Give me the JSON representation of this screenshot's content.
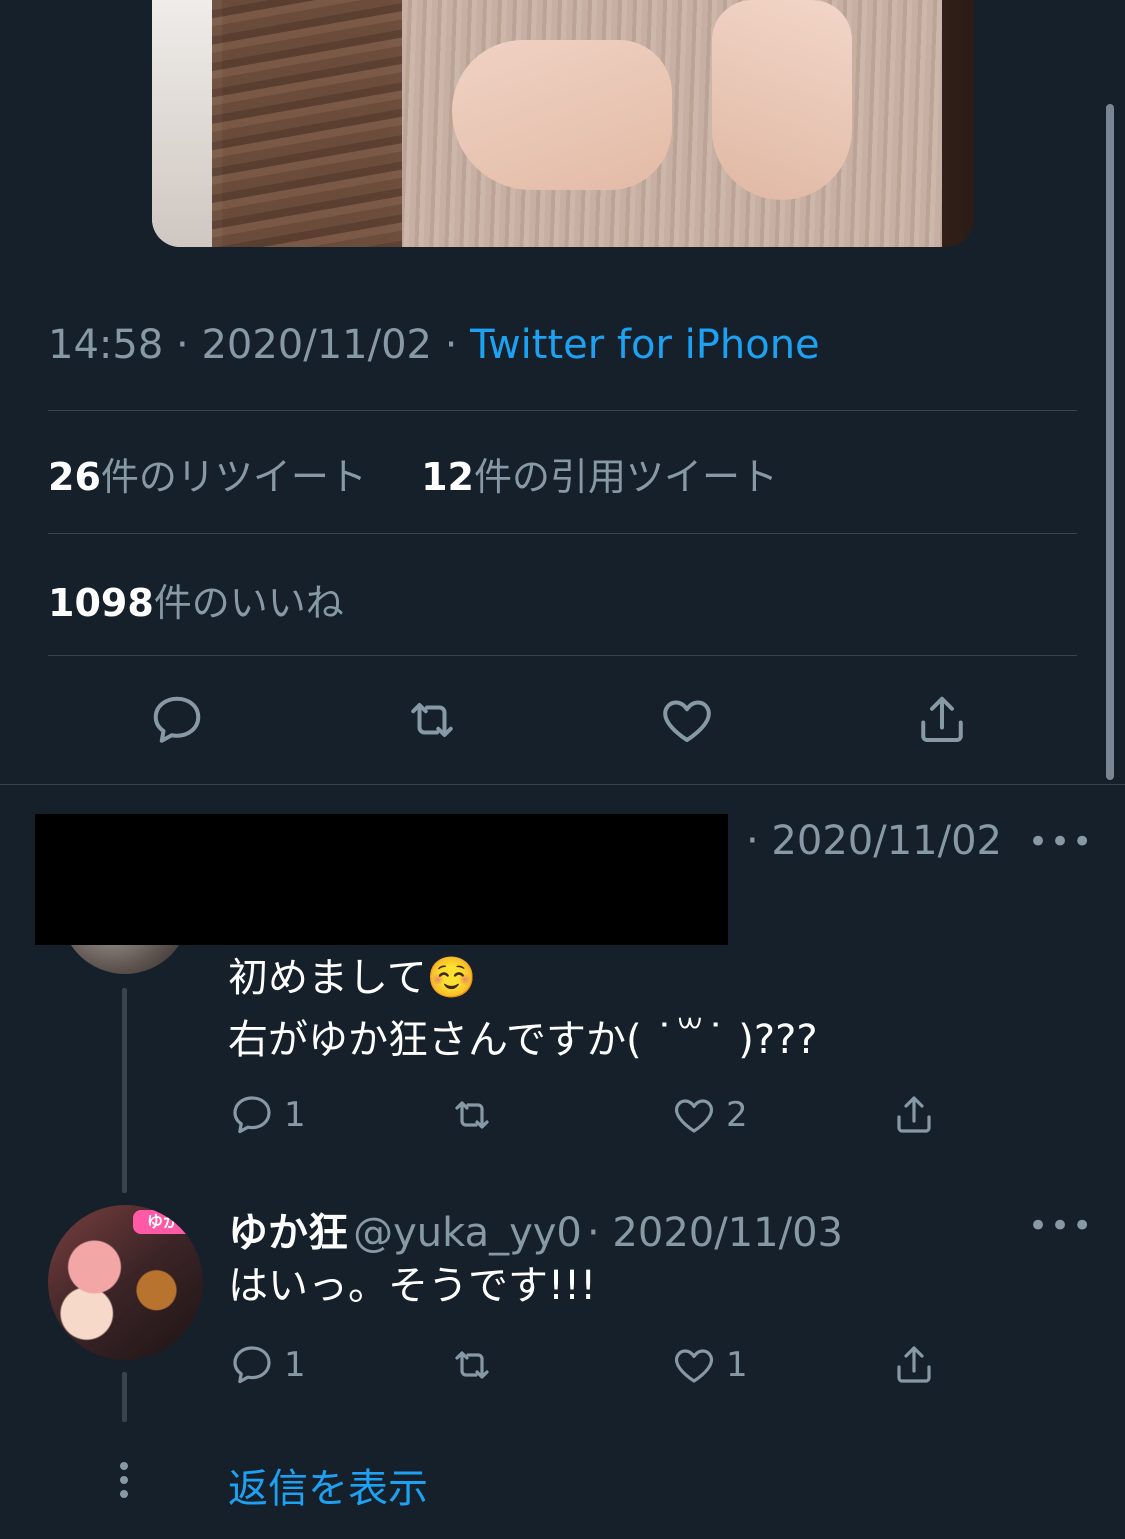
{
  "tweet": {
    "time": "14:58",
    "date": "2020/11/02",
    "source": "Twitter for iPhone",
    "retweets_count": "26",
    "retweets_label": "件のリツイート",
    "quotes_count": "12",
    "quotes_label": "件の引用ツイート",
    "likes_count": "1098",
    "likes_label": "件のいいね"
  },
  "replies": [
    {
      "date": "· 2020/11/02",
      "line1": "初めまして☺️",
      "line2": "右がゆか狂さんですか( ˙꒳˙ )???",
      "reply_count": "1",
      "retweet_count": "",
      "like_count": "2"
    },
    {
      "username": "ゆか狂",
      "handle": "@yuka_yy0",
      "date": "· 2020/11/03",
      "text": "はいっ。そうです!!!",
      "reply_count": "1",
      "retweet_count": "",
      "like_count": "1",
      "avatar_badge": "ゆか"
    }
  ],
  "show_replies": "返信を表示",
  "more_symbol": "•••",
  "colors": {
    "background": "#15202b",
    "accent": "#1da1f2",
    "muted": "#8899a6",
    "divider": "#38444d"
  },
  "icons": [
    "reply-icon",
    "retweet-icon",
    "like-icon",
    "share-icon",
    "more-icon"
  ]
}
